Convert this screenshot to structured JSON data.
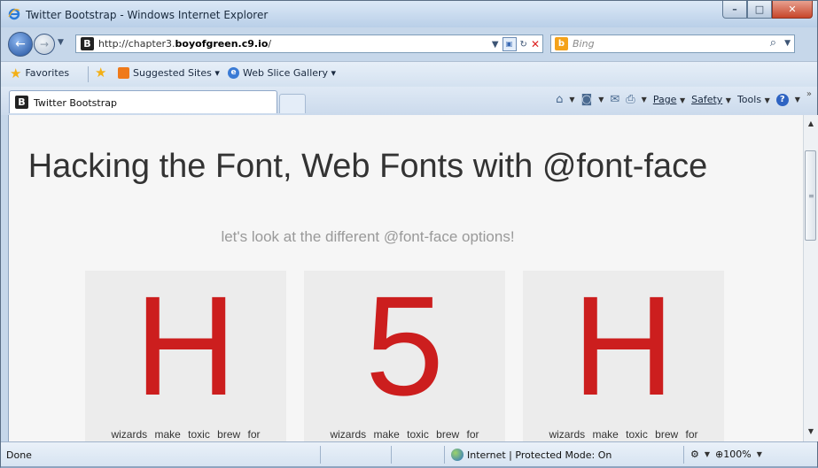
{
  "window": {
    "title": "Twitter Bootstrap - Windows Internet Explorer",
    "min_label": "–",
    "max_label": "□",
    "close_label": "✕"
  },
  "address_bar": {
    "url_prefix": "http://chapter3.",
    "url_domain": "boyofgreen.c9.io",
    "url_suffix": "/",
    "search_placeholder": "Bing"
  },
  "favorites_bar": {
    "favorites_label": "Favorites",
    "suggested_sites_label": "Suggested Sites ▾",
    "web_slice_gallery_label": "Web Slice Gallery ▾"
  },
  "tab": {
    "title": "Twitter Bootstrap"
  },
  "command_bar": {
    "page_label": "Page",
    "safety_label": "Safety",
    "tools_label": "Tools"
  },
  "page": {
    "title": "Hacking the Font, Web Fonts with @font-face",
    "subtitle": "let's look at the different @font-face options!",
    "cards": [
      {
        "glyph": "H",
        "text": "wizards make toxic brew for"
      },
      {
        "glyph": "5",
        "text": "wizards make toxic brew for"
      },
      {
        "glyph": "H",
        "text": "wizards make toxic brew for"
      }
    ],
    "accent_color": "#cc1e1e"
  },
  "status_bar": {
    "status": "Done",
    "zone": "Internet | Protected Mode: On",
    "zoom": "100%"
  }
}
